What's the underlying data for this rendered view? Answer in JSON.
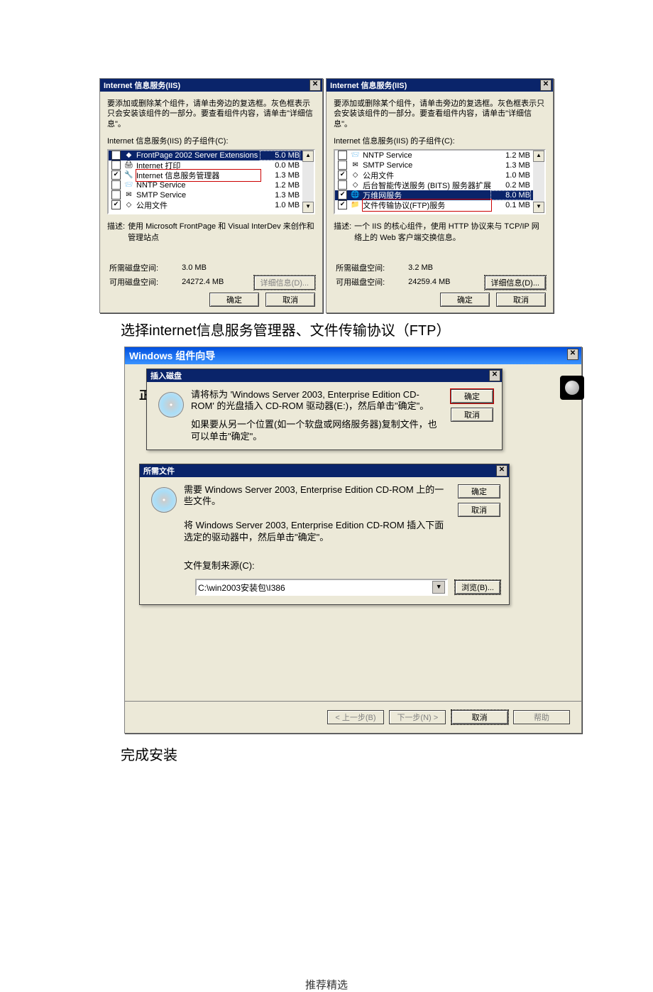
{
  "caption1": "选择internet信息服务管理器、文件传输协议（FTP）",
  "caption2": "完成安装",
  "footer": "推荐精选",
  "common": {
    "ok": "确定",
    "cancel": "取消",
    "details": "详细信息(D)...",
    "desc_label": "描述:",
    "need_label": "所需磁盘空间:",
    "avail_label": "可用磁盘空间:",
    "instr": "要添加或删除某个组件，请单击旁边的复选框。灰色框表示只会安装该组件的一部分。要查看组件内容，请单击\"详细信息\"。",
    "sublabel": "Internet 信息服务(IIS) 的子组件(C):"
  },
  "left": {
    "title": "Internet 信息服务(IIS)",
    "items": [
      {
        "checked": false,
        "icon": "◆",
        "label": "FrontPage 2002 Server Extensions",
        "size": "5.0 MB",
        "selected": true
      },
      {
        "checked": false,
        "icon": "🖨",
        "label": "Internet 打印",
        "size": "0.0 MB"
      },
      {
        "checked": true,
        "icon": "🔧",
        "label": "Internet 信息服务管理器",
        "size": "1.3 MB",
        "outline": true
      },
      {
        "checked": false,
        "icon": "📨",
        "label": "NNTP Service",
        "size": "1.2 MB"
      },
      {
        "checked": false,
        "icon": "✉",
        "label": "SMTP Service",
        "size": "1.3 MB"
      },
      {
        "checked": true,
        "icon": "◇",
        "label": "公用文件",
        "size": "1.0 MB"
      }
    ],
    "desc": "使用 Microsoft FrontPage 和 Visual InterDev 来创作和管理站点",
    "need": "3.0 MB",
    "avail": "24272.4 MB"
  },
  "right": {
    "title": "Internet 信息服务(IIS)",
    "items": [
      {
        "checked": false,
        "icon": "📨",
        "label": "NNTP Service",
        "size": "1.2 MB"
      },
      {
        "checked": false,
        "icon": "✉",
        "label": "SMTP Service",
        "size": "1.3 MB"
      },
      {
        "checked": true,
        "icon": "◇",
        "label": "公用文件",
        "size": "1.0 MB"
      },
      {
        "checked": false,
        "icon": "◇",
        "label": "后台智能传送服务 (BITS) 服务器扩展",
        "size": "0.2 MB"
      },
      {
        "checked": true,
        "icon": "🌐",
        "label": "万维网服务",
        "size": "8.0 MB",
        "selected": true
      },
      {
        "checked": true,
        "icon": "📁",
        "label": "文件传输协议(FTP)服务",
        "size": "0.1 MB",
        "outline": true
      }
    ],
    "desc": "一个 IIS 的核心组件，使用 HTTP 协议来与 TCP/IP 网络上的 Web 客户端交换信息。",
    "need": "3.2 MB",
    "avail": "24259.4 MB"
  },
  "wizard": {
    "title": "Windows 组件向导",
    "zheng": "正",
    "insert": {
      "title": "插入磁盘",
      "text1": "请将标为 'Windows Server 2003, Enterprise Edition CD-ROM' 的光盘插入 CD-ROM 驱动器(E:)，然后单击\"确定\"。",
      "text2": "如果要从另一个位置(如一个软盘或网络服务器)复制文件，也可以单击\"确定\"。",
      "ok": "确定",
      "cancel": "取消"
    },
    "needfiles": {
      "title": "所需文件",
      "text1": "需要 Windows Server 2003, Enterprise Edition CD-ROM 上的一些文件。",
      "text2": "将 Windows Server 2003, Enterprise Edition CD-ROM 插入下面选定的驱动器中，然后单击\"确定\"。",
      "srclabel": "文件复制来源(C):",
      "path": "C:\\win2003安装包\\I386",
      "browse": "浏览(B)...",
      "ok": "确定",
      "cancel": "取消"
    },
    "buttons": {
      "back": "< 上一步(B)",
      "next": "下一步(N) >",
      "cancel": "取消",
      "help": "帮助"
    }
  }
}
